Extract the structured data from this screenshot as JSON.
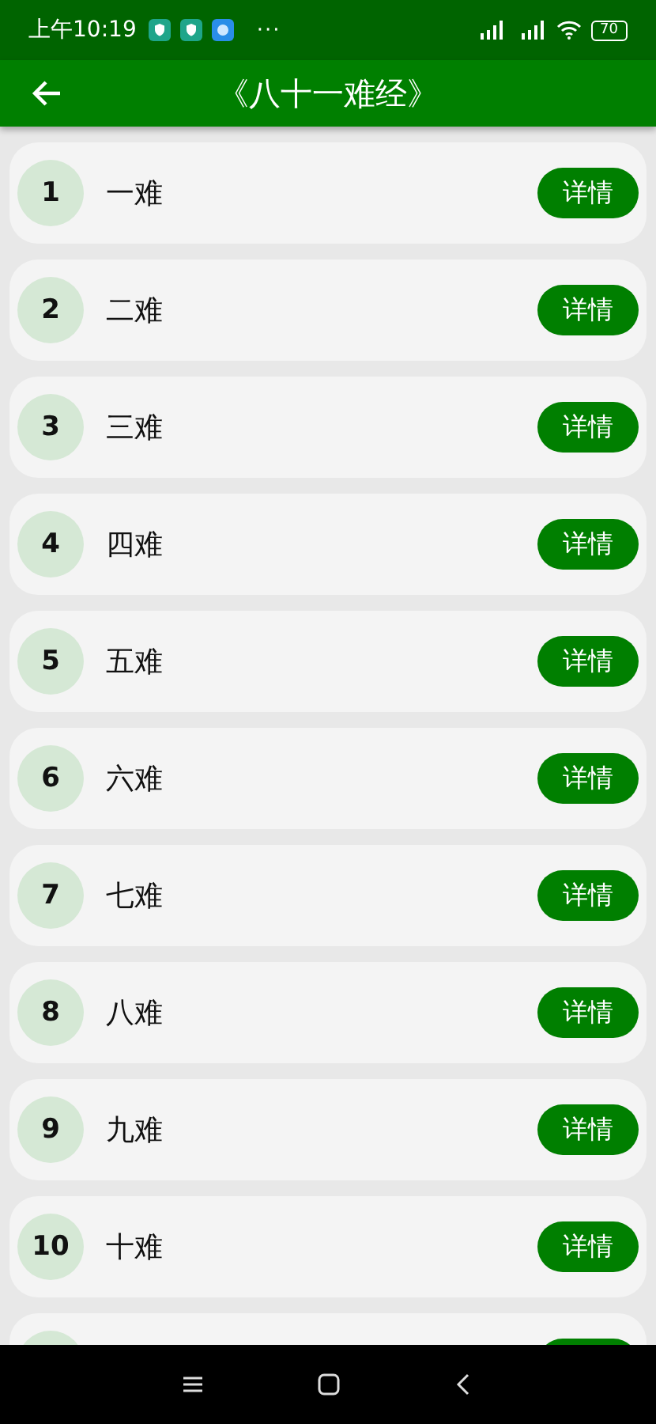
{
  "status_bar": {
    "time": "上午10:19",
    "more": "···",
    "battery": "70"
  },
  "app_bar": {
    "title": "《八十一难经》"
  },
  "items": [
    {
      "number": "1",
      "title": "一难",
      "button": "详情"
    },
    {
      "number": "2",
      "title": "二难",
      "button": "详情"
    },
    {
      "number": "3",
      "title": "三难",
      "button": "详情"
    },
    {
      "number": "4",
      "title": "四难",
      "button": "详情"
    },
    {
      "number": "5",
      "title": "五难",
      "button": "详情"
    },
    {
      "number": "6",
      "title": "六难",
      "button": "详情"
    },
    {
      "number": "7",
      "title": "七难",
      "button": "详情"
    },
    {
      "number": "8",
      "title": "八难",
      "button": "详情"
    },
    {
      "number": "9",
      "title": "九难",
      "button": "详情"
    },
    {
      "number": "10",
      "title": "十难",
      "button": "详情"
    }
  ]
}
